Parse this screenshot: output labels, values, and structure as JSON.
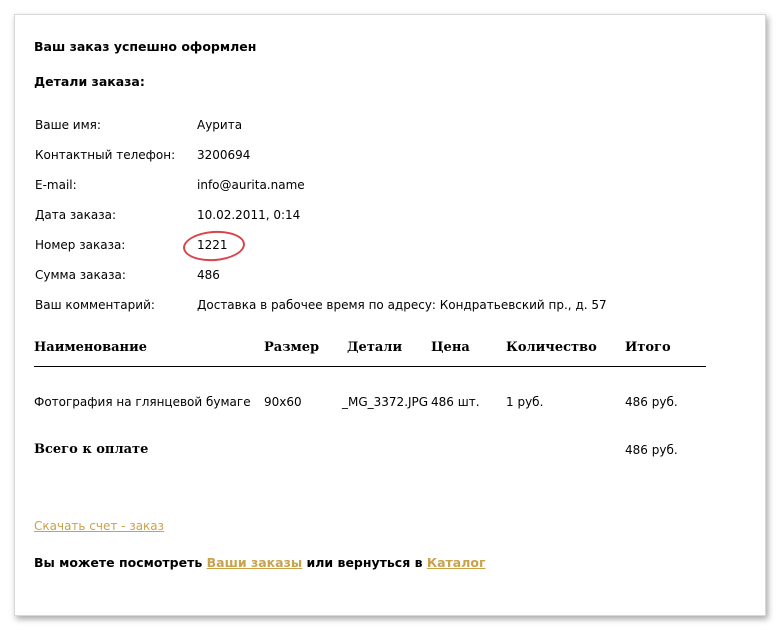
{
  "page": {
    "title": "Ваш заказ успешно оформлен",
    "subtitle": "Детали заказа:"
  },
  "details": [
    {
      "label": "Ваше имя:",
      "value": "Аурита"
    },
    {
      "label": "Контактный телефон:",
      "value": "3200694"
    },
    {
      "label": "E-mail:",
      "value": "info@aurita.name"
    },
    {
      "label": "Дата заказа:",
      "value": "10.02.2011, 0:14"
    },
    {
      "label": "Номер заказа:",
      "value": "1221"
    },
    {
      "label": "Сумма заказа:",
      "value": "486"
    },
    {
      "label": "Ваш комментарий:",
      "value": "Доставка в рабочее время по адресу: Кондратьевский пр., д. 57"
    }
  ],
  "table": {
    "headers": [
      "Наименование",
      "Размер",
      "Детали",
      "Цена",
      "Количество",
      "Итого"
    ],
    "rows": [
      [
        "Фотография на глянцевой бумаге",
        "90x60",
        "_MG_3372.JPG",
        "486 шт.",
        "1 руб.",
        "486 руб."
      ]
    ],
    "total_label": "Всего к оплате",
    "total_value": "486 руб."
  },
  "links": {
    "download": "Скачать счет - заказ",
    "prefix": "Вы можете посмотреть",
    "orders": "Ваши заказы",
    "middle": "или вернуться в",
    "catalog": "Каталог"
  },
  "colors": {
    "link": "#c9a24c",
    "highlight_circle": "#d9434b"
  }
}
